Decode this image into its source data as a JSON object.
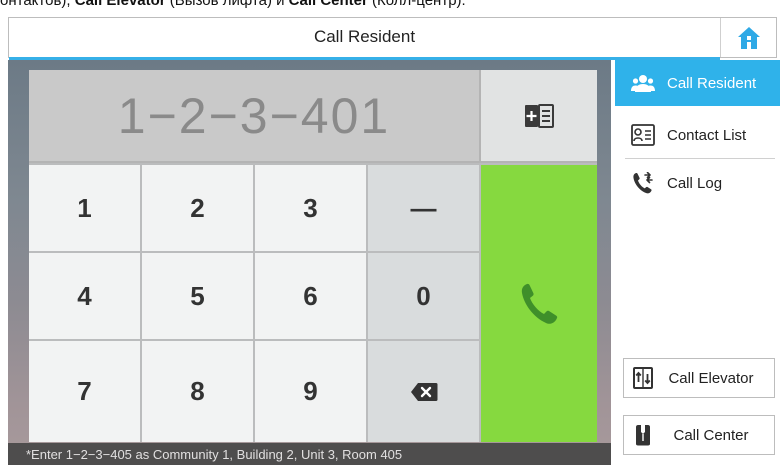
{
  "caption": {
    "before": "онтактов),",
    "bold1": "Call Elevator",
    "mid": "(Вызов лифта) и",
    "bold2": "Call Center",
    "after": "(Колл-центр)."
  },
  "header": {
    "title": "Call Resident"
  },
  "display": {
    "value": "1−2−3−401"
  },
  "keypad": {
    "keys": [
      "1",
      "2",
      "3",
      "—",
      "4",
      "5",
      "6",
      "0",
      "7",
      "8",
      "9"
    ]
  },
  "hint": "*Enter 1−2−3−405 as Community 1, Building 2, Unit 3, Room 405",
  "sidebar": {
    "items": [
      {
        "label": "Call Resident",
        "icon": "people-icon",
        "active": true
      },
      {
        "label": "Contact List",
        "icon": "contact-card-icon",
        "active": false
      },
      {
        "label": "Call Log",
        "icon": "call-log-icon",
        "active": false
      }
    ],
    "buttons": [
      {
        "label": "Call Elevator",
        "icon": "elevator-icon"
      },
      {
        "label": "Call Center",
        "icon": "call-center-icon"
      }
    ]
  },
  "colors": {
    "accent": "#2fb2ea",
    "call_green": "#86d93f",
    "phone_icon_green": "#3f8f2a"
  }
}
